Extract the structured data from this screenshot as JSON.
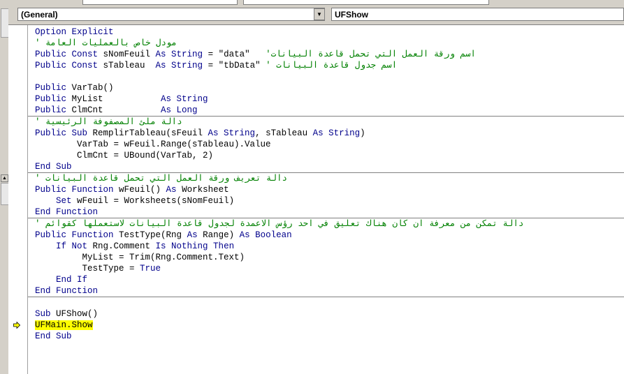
{
  "header": {
    "object_combo": "(General)",
    "procedure_combo": "UFShow"
  },
  "code_lines": [
    {
      "parts": [
        [
          "kw",
          "Option Explicit"
        ]
      ]
    },
    {
      "parts": [
        [
          "cm",
          "' مودل خاص بالعمليات العامة"
        ]
      ]
    },
    {
      "parts": [
        [
          "kw",
          "Public Const "
        ],
        [
          "tx",
          "sNomFeuil "
        ],
        [
          "kw",
          "As String"
        ],
        [
          "tx",
          " = \"data\"   "
        ],
        [
          "cm",
          "'اسم ورقة العمل التي تحمل قاعدة البيانات"
        ]
      ]
    },
    {
      "parts": [
        [
          "kw",
          "Public Const "
        ],
        [
          "tx",
          "sTableau  "
        ],
        [
          "kw",
          "As String"
        ],
        [
          "tx",
          " = \"tbData\" "
        ],
        [
          "cm",
          "' اسم جدول قاعدة البيانات"
        ]
      ]
    },
    {
      "parts": []
    },
    {
      "parts": [
        [
          "kw",
          "Public "
        ],
        [
          "tx",
          "VarTab()"
        ]
      ]
    },
    {
      "parts": [
        [
          "kw",
          "Public "
        ],
        [
          "tx",
          "MyList           "
        ],
        [
          "kw",
          "As String"
        ]
      ]
    },
    {
      "parts": [
        [
          "kw",
          "Public "
        ],
        [
          "tx",
          "ClmCnt           "
        ],
        [
          "kw",
          "As Long"
        ]
      ]
    },
    {
      "sep": true,
      "parts": [
        [
          "cm",
          "' دالة ملئ المصفوفة الرئيسية"
        ]
      ]
    },
    {
      "parts": [
        [
          "kw",
          "Public Sub "
        ],
        [
          "tx",
          "RemplirTableau(sFeuil "
        ],
        [
          "kw",
          "As String"
        ],
        [
          "tx",
          ", sTableau "
        ],
        [
          "kw",
          "As String"
        ],
        [
          "tx",
          ")"
        ]
      ]
    },
    {
      "parts": [
        [
          "tx",
          "        VarTab = wFeuil.Range(sTableau).Value"
        ]
      ]
    },
    {
      "parts": [
        [
          "tx",
          "        ClmCnt = UBound(VarTab, 2)"
        ]
      ]
    },
    {
      "parts": [
        [
          "kw",
          "End Sub"
        ]
      ]
    },
    {
      "sep": true,
      "parts": [
        [
          "cm",
          "' دالة تعريف ورقة العمل التي تحمل قاعدة البيانات"
        ]
      ]
    },
    {
      "parts": [
        [
          "kw",
          "Public Function "
        ],
        [
          "tx",
          "wFeuil() "
        ],
        [
          "kw",
          "As "
        ],
        [
          "tx",
          "Worksheet"
        ]
      ]
    },
    {
      "parts": [
        [
          "tx",
          "    "
        ],
        [
          "kw",
          "Set "
        ],
        [
          "tx",
          "wFeuil = Worksheets(sNomFeuil)"
        ]
      ]
    },
    {
      "parts": [
        [
          "kw",
          "End Function"
        ]
      ]
    },
    {
      "sep": true,
      "parts": [
        [
          "cm",
          "' دالة تمكن من معرفة ان كان هناك تعليق في احد رؤس الاعمدة لجدول قاعدة البيانات لاستعملها كقوائم"
        ]
      ]
    },
    {
      "parts": [
        [
          "kw",
          "Public Function "
        ],
        [
          "tx",
          "TestType(Rng "
        ],
        [
          "kw",
          "As "
        ],
        [
          "tx",
          "Range) "
        ],
        [
          "kw",
          "As Boolean"
        ]
      ]
    },
    {
      "parts": [
        [
          "tx",
          "    "
        ],
        [
          "kw",
          "If Not "
        ],
        [
          "tx",
          "Rng.Comment "
        ],
        [
          "kw",
          "Is Nothing Then"
        ]
      ]
    },
    {
      "parts": [
        [
          "tx",
          "         MyList = Trim(Rng.Comment.Text)"
        ]
      ]
    },
    {
      "parts": [
        [
          "tx",
          "         TestType = "
        ],
        [
          "kw",
          "True"
        ]
      ]
    },
    {
      "parts": [
        [
          "tx",
          "    "
        ],
        [
          "kw",
          "End If"
        ]
      ]
    },
    {
      "parts": [
        [
          "kw",
          "End Function"
        ]
      ]
    },
    {
      "sep": true,
      "parts": []
    },
    {
      "parts": [
        [
          "kw",
          "Sub "
        ],
        [
          "tx",
          "UFShow()"
        ]
      ]
    },
    {
      "exec": true,
      "parts": [
        [
          "hl",
          "UFMain.Show"
        ]
      ]
    },
    {
      "parts": [
        [
          "kw",
          "End Sub"
        ]
      ]
    }
  ]
}
